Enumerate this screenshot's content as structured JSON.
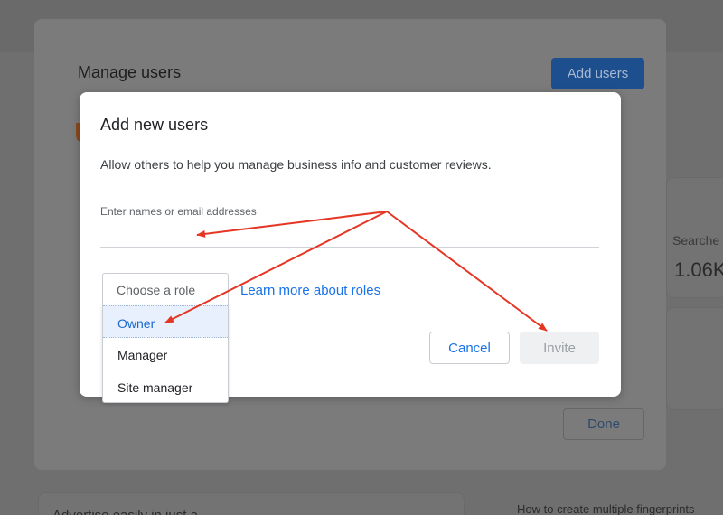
{
  "background": {
    "stat_label": "Searche",
    "stat_value": "1.06K",
    "bottom_left_text": "Advertise easily in just a",
    "bottom_right_text": "How to create multiple fingerprints"
  },
  "manage_dialog": {
    "title": "Manage users",
    "add_users_label": "Add users",
    "done_label": "Done"
  },
  "add_dialog": {
    "title": "Add new users",
    "description": "Allow others to help you manage business info and customer reviews.",
    "email_label": "Enter names or email addresses",
    "email_value": "",
    "role_placeholder": "Choose a role",
    "role_options": [
      "Owner",
      "Manager",
      "Site manager"
    ],
    "highlighted_role": "Owner",
    "learn_more_label": "Learn more about roles",
    "cancel_label": "Cancel",
    "invite_label": "Invite"
  },
  "colors": {
    "accent": "#1a73e8",
    "annotation_arrow": "#e53624"
  }
}
